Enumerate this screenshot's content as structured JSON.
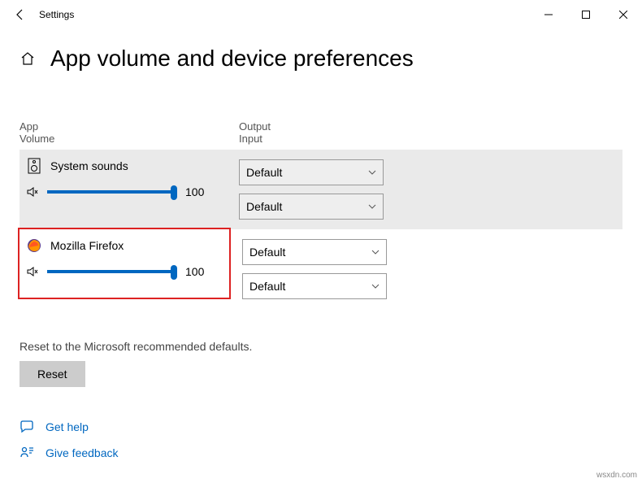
{
  "window": {
    "app_title": "Settings"
  },
  "page": {
    "title": "App volume and device preferences"
  },
  "columns": {
    "app": "App",
    "volume": "Volume",
    "output": "Output",
    "input": "Input"
  },
  "apps": [
    {
      "name": "System sounds",
      "volume": 100,
      "output": "Default",
      "input": "Default"
    },
    {
      "name": "Mozilla Firefox",
      "volume": 100,
      "output": "Default",
      "input": "Default"
    }
  ],
  "reset": {
    "description": "Reset to the Microsoft recommended defaults.",
    "button": "Reset"
  },
  "links": {
    "help": "Get help",
    "feedback": "Give feedback"
  },
  "watermark": "wsxdn.com"
}
